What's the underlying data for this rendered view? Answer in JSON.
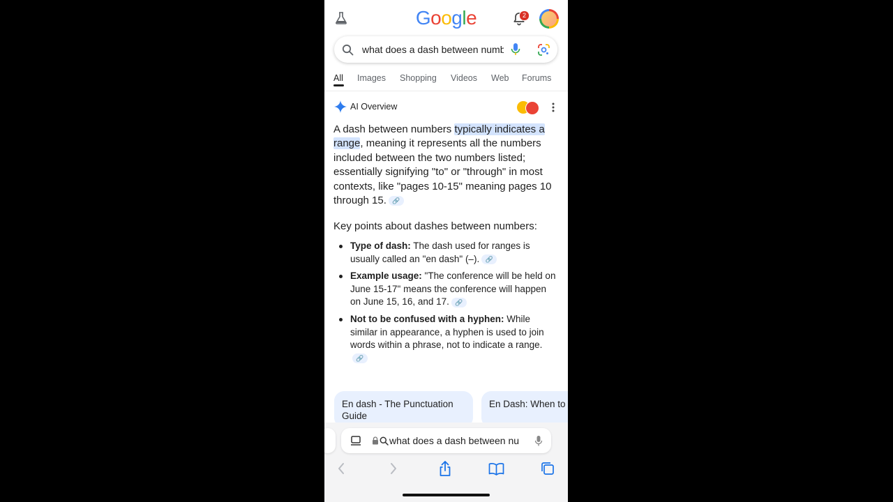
{
  "header": {
    "logo_letters": [
      {
        "ch": "G",
        "color": "#4285f4"
      },
      {
        "ch": "o",
        "color": "#ea4335"
      },
      {
        "ch": "o",
        "color": "#fbbc05"
      },
      {
        "ch": "g",
        "color": "#4285f4"
      },
      {
        "ch": "l",
        "color": "#34a853"
      },
      {
        "ch": "e",
        "color": "#ea4335"
      }
    ],
    "notification_count": "2"
  },
  "search": {
    "query": "what does a dash between numb"
  },
  "tabs": [
    "All",
    "Images",
    "Shopping",
    "Videos",
    "Web",
    "Forums"
  ],
  "ai_overview": {
    "label": "AI Overview",
    "para_lead": "A dash between numbers ",
    "para_highlight_1": "typically indicates a",
    "para_highlight_2": "range",
    "para_rest": ", meaning it represents all the numbers included between the two numbers listed; essentially signifying \"to\" or \"through\" in most contexts, like \"pages 10-15\" meaning pages 10 through 15.",
    "key_points_heading": "Key points about dashes between numbers:",
    "key_points": [
      {
        "title": "Type of dash:",
        "text": " The dash used for ranges is usually called an \"en dash\" (–)."
      },
      {
        "title": "Example usage:",
        "text": " \"The conference will be held on June 15-17\" means the conference will happen on June 15, 16, and 17."
      },
      {
        "title": "Not to be confused with a hyphen:",
        "text": " While similar in appearance, a hyphen is used to join words within a phrase, not to indicate a range."
      }
    ]
  },
  "source_cards": [
    {
      "title": "En dash - The Punctuation Guide"
    },
    {
      "title": "En Dash: When to (with Examples) -..."
    }
  ],
  "browser": {
    "url_text": "what does a dash between nu"
  },
  "colors": {
    "highlight": "#d3e3fd",
    "card_bg": "#e8f0fe",
    "accent_blue": "#4285f4"
  }
}
